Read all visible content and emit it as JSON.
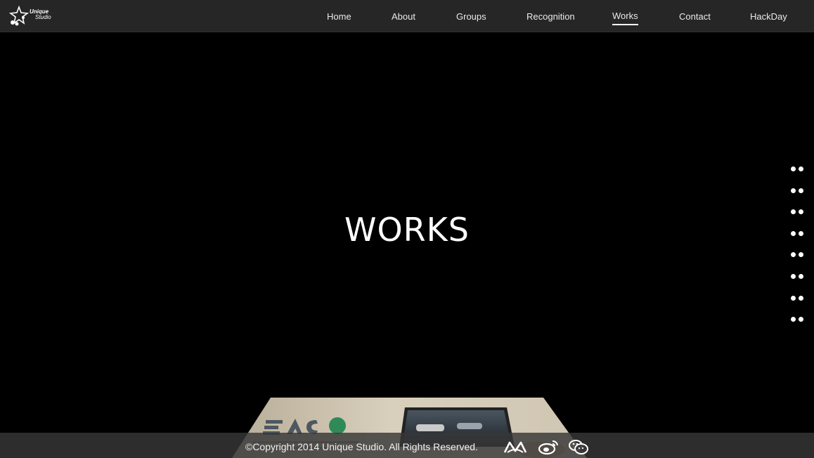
{
  "brand": {
    "logo_line1": "Unique",
    "logo_line2": "Studio"
  },
  "nav": {
    "items": [
      {
        "label": "Home"
      },
      {
        "label": "About"
      },
      {
        "label": "Groups"
      },
      {
        "label": "Recognition"
      },
      {
        "label": "Works",
        "active": true
      },
      {
        "label": "Contact"
      },
      {
        "label": "HackDay"
      }
    ]
  },
  "hero": {
    "title": "WORKS"
  },
  "dot_nav": {
    "count": 8
  },
  "card": {
    "brand_text": "EACO"
  },
  "footer": {
    "copyright": "©Copyright 2014 Unique Studio. All Rights Reserved.",
    "social_icons": [
      "dribbble-like-icon",
      "weibo-icon",
      "wechat-icon"
    ]
  },
  "colors": {
    "topbar": "#262626",
    "background": "#000000",
    "footer": "#373737",
    "text": "#ffffff"
  }
}
